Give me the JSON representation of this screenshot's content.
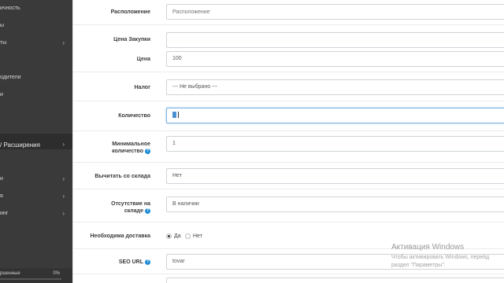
{
  "sidebar": {
    "items": [
      {
        "label": "ичность",
        "chevron": ""
      },
      {
        "label": "ы",
        "chevron": ""
      },
      {
        "label": "ты",
        "chevron": "›"
      },
      {
        "label": "",
        "chevron": ""
      },
      {
        "label": "одители",
        "chevron": ""
      },
      {
        "label": "и",
        "chevron": ""
      },
      {
        "label": "",
        "chevron": ""
      },
      {
        "label": "/ Расширения",
        "chevron": "›"
      },
      {
        "label": "",
        "chevron": "›"
      },
      {
        "label": "и",
        "chevron": "›"
      },
      {
        "label": "я",
        "chevron": "›"
      },
      {
        "label": "инг",
        "chevron": "›"
      },
      {
        "label": "",
        "chevron": "›"
      },
      {
        "label": "",
        "chevron": "›"
      }
    ],
    "progress": {
      "label": "ршенные",
      "percent_text": "0%",
      "value": 0
    }
  },
  "form": {
    "location": {
      "label": "Расположение",
      "placeholder": "Расположение"
    },
    "purchase_price": {
      "label": "Цена Закупки",
      "value": ""
    },
    "price": {
      "label": "Цена",
      "value": "100"
    },
    "tax": {
      "label": "Налог",
      "value": "--- Не выбрано ---"
    },
    "quantity": {
      "label": "Количество",
      "value": ""
    },
    "min_quantity": {
      "label_line1": "Минимальное",
      "label_line2": "количество",
      "value": "1"
    },
    "subtract": {
      "label": "Вычитать со склада",
      "value": "Нет"
    },
    "out_of_stock": {
      "label_line1": "Отсутствие на",
      "label_line2": "складе",
      "value": "В наличии"
    },
    "shipping": {
      "label": "Необходима доставка",
      "option_yes": "Да",
      "option_no": "Нет",
      "selected": "yes"
    },
    "seo_url": {
      "label": "SEO URL",
      "value": "tovar"
    }
  },
  "watermark": {
    "title": "Активация Windows",
    "line1": "Чтобы активировать Windows, перейд",
    "line2": "раздел \"Параметры\"."
  },
  "colors": {
    "sidebar_bg": "#3a3a3a",
    "help_icon": "#1f8dd6",
    "focus_border": "#7fb2e0"
  }
}
